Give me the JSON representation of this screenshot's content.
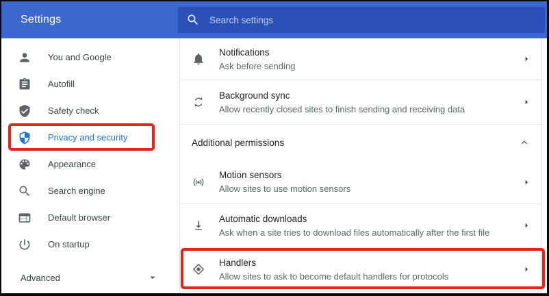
{
  "header": {
    "title": "Settings",
    "search_placeholder": "Search settings",
    "search_icon": "magnifier-icon"
  },
  "sidebar": {
    "items": [
      {
        "label": "You and Google",
        "icon": "person-icon",
        "selected": false
      },
      {
        "label": "Autofill",
        "icon": "clipboard-icon",
        "selected": false
      },
      {
        "label": "Safety check",
        "icon": "shield-check-icon",
        "selected": false
      },
      {
        "label": "Privacy and security",
        "icon": "shield-half-icon",
        "selected": true,
        "annotated": true
      },
      {
        "label": "Appearance",
        "icon": "palette-icon",
        "selected": false
      },
      {
        "label": "Search engine",
        "icon": "magnifier-icon",
        "selected": false
      },
      {
        "label": "Default browser",
        "icon": "browser-window-icon",
        "selected": false
      },
      {
        "label": "On startup",
        "icon": "power-icon",
        "selected": false
      }
    ],
    "advanced": {
      "label": "Advanced",
      "expanded": false,
      "icon": "caret-down-icon"
    }
  },
  "content": {
    "rows": [
      {
        "title": "Notifications",
        "subtitle": "Ask before sending",
        "icon": "bell-icon",
        "has_chevron": true
      },
      {
        "title": "Background sync",
        "subtitle": "Allow recently closed sites to finish sending and receiving data",
        "icon": "sync-icon",
        "has_chevron": true
      }
    ],
    "section": {
      "header": "Additional permissions",
      "collapse_icon": "chevron-up-icon",
      "rows": [
        {
          "title": "Motion sensors",
          "subtitle": "Allow sites to use motion sensors",
          "icon": "motion-sensor-icon",
          "has_chevron": true
        },
        {
          "title": "Automatic downloads",
          "subtitle": "Ask when a site tries to download files automatically after the first file",
          "icon": "download-icon",
          "has_chevron": true
        },
        {
          "title": "Handlers",
          "subtitle": "Allow sites to ask to become default handlers for protocols",
          "icon": "handlers-icon",
          "has_chevron": true,
          "annotated": true
        }
      ]
    }
  },
  "annotations": {
    "highlight_color": "#E3241B",
    "highlighted_items": [
      "Privacy and security",
      "Handlers"
    ]
  },
  "colors": {
    "header_bg": "#3B67CF",
    "search_bg": "#2B51B8",
    "accent_blue": "#1A73E8",
    "annotation_red": "#E3241B",
    "title_text": "#202124",
    "secondary_text": "#5F6368"
  }
}
